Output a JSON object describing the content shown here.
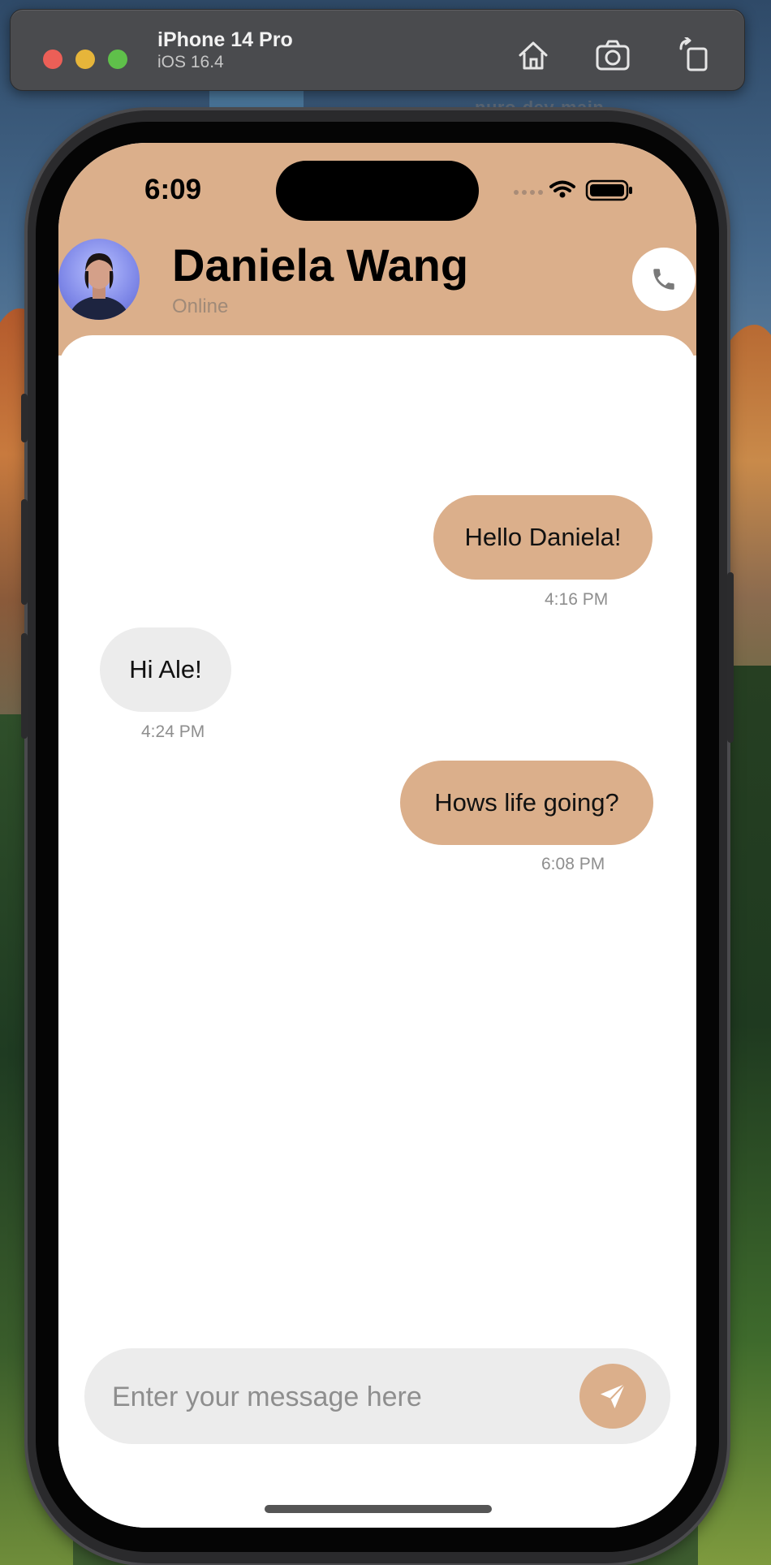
{
  "simulator": {
    "device_name": "iPhone 14 Pro",
    "os_version": "iOS 16.4",
    "tools": [
      "home-icon",
      "screenshot-icon",
      "rotate-icon"
    ]
  },
  "desktop": {
    "background_label": "nuro-dev-main"
  },
  "status_bar": {
    "time": "6:09"
  },
  "chat_header": {
    "contact_name": "Daniela Wang",
    "presence": "Online",
    "call_icon": "phone-icon"
  },
  "messages": [
    {
      "direction": "outgoing",
      "text": "Hello Daniela!",
      "time": "4:16 PM"
    },
    {
      "direction": "incoming",
      "text": "Hi Ale!",
      "time": "4:24 PM"
    },
    {
      "direction": "outgoing",
      "text": "Hows life going?",
      "time": "6:08 PM"
    }
  ],
  "composer": {
    "placeholder": "Enter your message here",
    "value": "",
    "send_icon": "send-icon"
  },
  "colors": {
    "accent": "#dbaf8b",
    "incoming_bubble": "#ececec",
    "timestamp": "#8e8e8e"
  }
}
